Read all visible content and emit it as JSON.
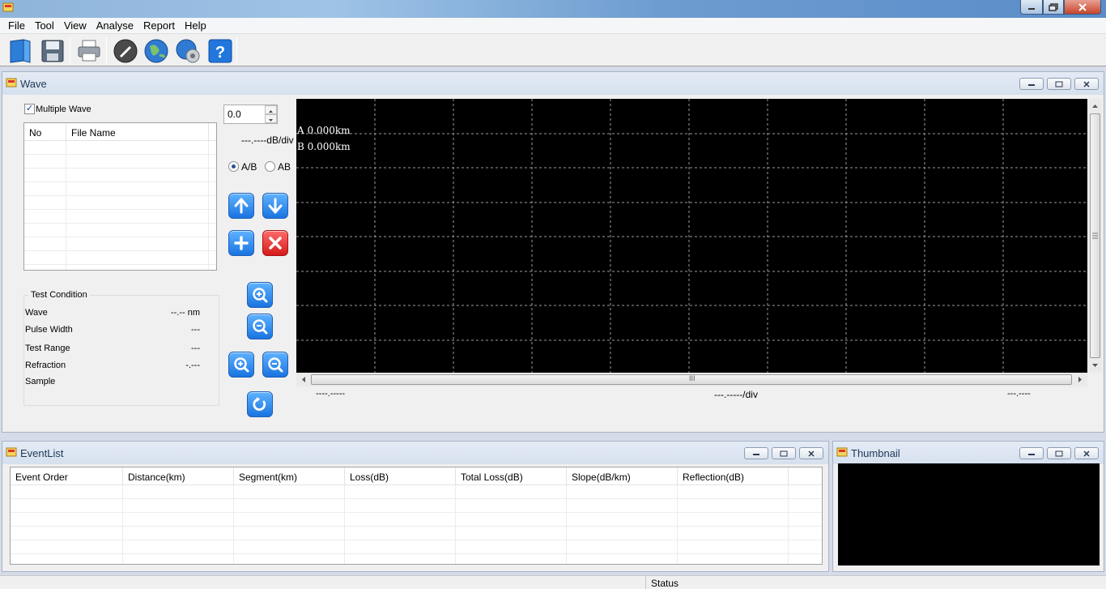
{
  "menu": [
    "File",
    "Tool",
    "View",
    "Analyse",
    "Report",
    "Help"
  ],
  "toolbar_icons": [
    "open-icon",
    "save-icon",
    "print-icon",
    "edit-icon",
    "globe-icon",
    "settings-globe-icon",
    "help-icon"
  ],
  "wave_panel": {
    "title": "Wave",
    "multiple_wave_label": "Multiple Wave",
    "multiple_wave_checked": true,
    "file_table": {
      "columns": [
        "No",
        "File Name"
      ],
      "rows": []
    },
    "test_condition": {
      "title": "Test Condition",
      "rows": [
        {
          "label": "Wave",
          "value": "--.-- nm"
        },
        {
          "label": "Pulse Width",
          "value": "---"
        },
        {
          "label": "Test Range",
          "value": "---"
        },
        {
          "label": "Refraction",
          "value": "-.---"
        },
        {
          "label": "Sample",
          "value": ""
        }
      ]
    },
    "spin_value": "0.0",
    "db_div": "---.----dB/div",
    "radio_ab_slash": "A/B",
    "radio_ab": "AB",
    "radio_selected": "A/B",
    "plot": {
      "marker_a": "A 0.000km",
      "marker_b": "B 0.000km",
      "x_left": "----.-----",
      "x_div": "---.-----/div",
      "x_right": "---.----",
      "scroll_grip": "III"
    }
  },
  "eventlist_panel": {
    "title": "EventList",
    "columns": [
      "Event Order",
      "Distance(km)",
      "Segment(km)",
      "Loss(dB)",
      "Total Loss(dB)",
      "Slope(dB/km)",
      "Reflection(dB)"
    ],
    "rows": []
  },
  "thumbnail_panel": {
    "title": "Thumbnail"
  },
  "status": {
    "text": "Status"
  },
  "colors": {
    "plot_bg": "#000000",
    "grid": "#9a9a9a",
    "button_blue": "#1a74e0",
    "button_red": "#d41b1b"
  }
}
